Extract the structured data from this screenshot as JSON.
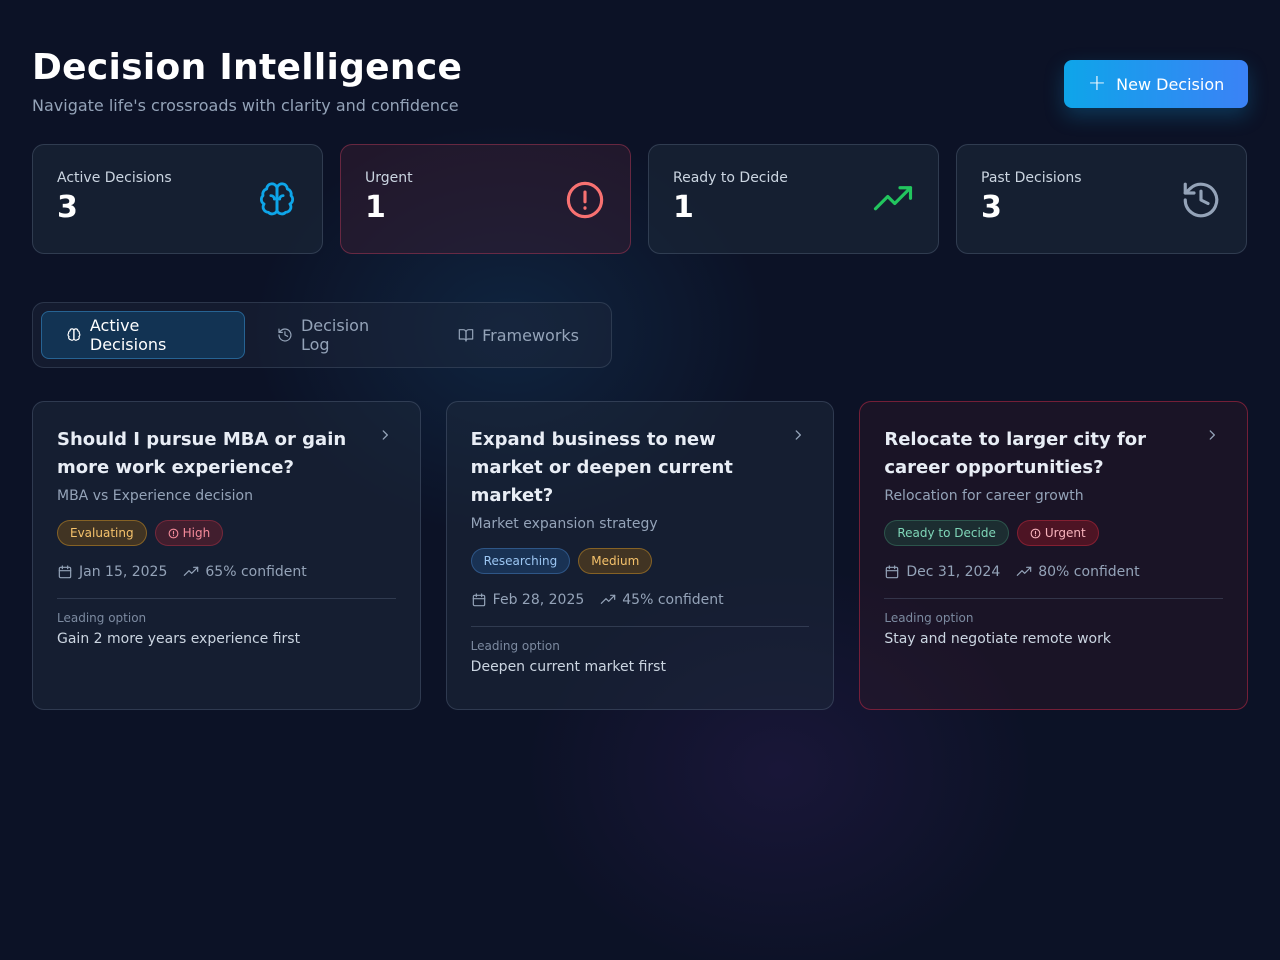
{
  "header": {
    "title": "Decision Intelligence",
    "subtitle": "Navigate life's crossroads with clarity and confidence",
    "new_button_label": "New Decision"
  },
  "stats": [
    {
      "label": "Active Decisions",
      "value": "3",
      "icon": "brain-icon",
      "color": "#0ea5e9"
    },
    {
      "label": "Urgent",
      "value": "1",
      "icon": "alert-circle-icon",
      "color": "#f87171"
    },
    {
      "label": "Ready to Decide",
      "value": "1",
      "icon": "trending-up-icon",
      "color": "#22c55e"
    },
    {
      "label": "Past Decisions",
      "value": "3",
      "icon": "history-icon",
      "color": "#94a3b8"
    }
  ],
  "tabs": [
    {
      "label": "Active Decisions",
      "icon": "brain-icon",
      "active": true
    },
    {
      "label": "Decision Log",
      "icon": "history-icon",
      "active": false
    },
    {
      "label": "Frameworks",
      "icon": "book-icon",
      "active": false
    }
  ],
  "cards": [
    {
      "title": "Should I pursue MBA or gain more work experience?",
      "subtitle": "MBA vs Experience decision",
      "status": "Evaluating",
      "priority": "High",
      "date": "Jan 15, 2025",
      "confidence": "65% confident",
      "leading_label": "Leading option",
      "leading_value": "Gain 2 more years experience first"
    },
    {
      "title": "Expand business to new market or deepen current market?",
      "subtitle": "Market expansion strategy",
      "status": "Researching",
      "priority": "Medium",
      "date": "Feb 28, 2025",
      "confidence": "45% confident",
      "leading_label": "Leading option",
      "leading_value": "Deepen current market first"
    },
    {
      "title": "Relocate to larger city for career opportunities?",
      "subtitle": "Relocation for career growth",
      "status": "Ready to Decide",
      "priority": "Urgent",
      "date": "Dec 31, 2024",
      "confidence": "80% confident",
      "leading_label": "Leading option",
      "leading_value": "Stay and negotiate remote work"
    }
  ],
  "colors": {
    "background": "#0c1226",
    "accent": "#0ea5e9",
    "accent_end": "#3b82f6",
    "urgent": "#e11d48"
  }
}
